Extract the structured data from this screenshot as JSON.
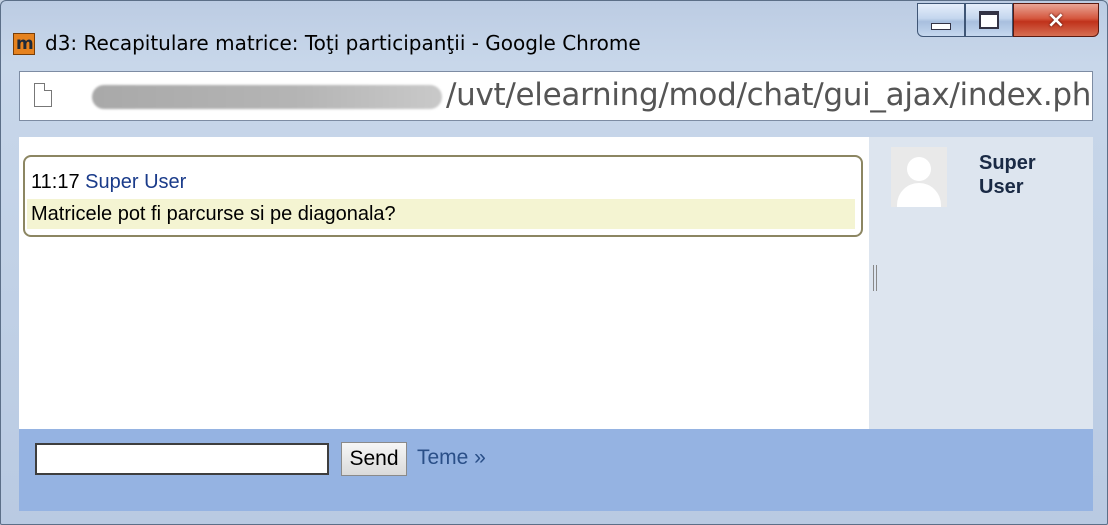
{
  "window": {
    "title": "d3: Recapitulare matrice: Toţi participanţii - Google Chrome",
    "logo_glyph": "m",
    "controls": {
      "minimize": "minimize",
      "maximize": "maximize",
      "close": "×"
    }
  },
  "address_bar": {
    "url_visible": "/uvt/elearning/mod/chat/gui_ajax/index.php?id="
  },
  "chat": {
    "messages": [
      {
        "time": "11:17",
        "user": "Super User",
        "text": "Matricele pot fi parcurse si pe diagonala?"
      }
    ]
  },
  "users": [
    {
      "name": "Super User"
    }
  ],
  "composer": {
    "input_value": "",
    "send_label": "Send",
    "theme_link": "Teme »"
  },
  "colors": {
    "user_pane_bg": "#dde5ef",
    "input_bar_bg": "#95b3e2",
    "message_highlight": "#f4f4d2"
  }
}
